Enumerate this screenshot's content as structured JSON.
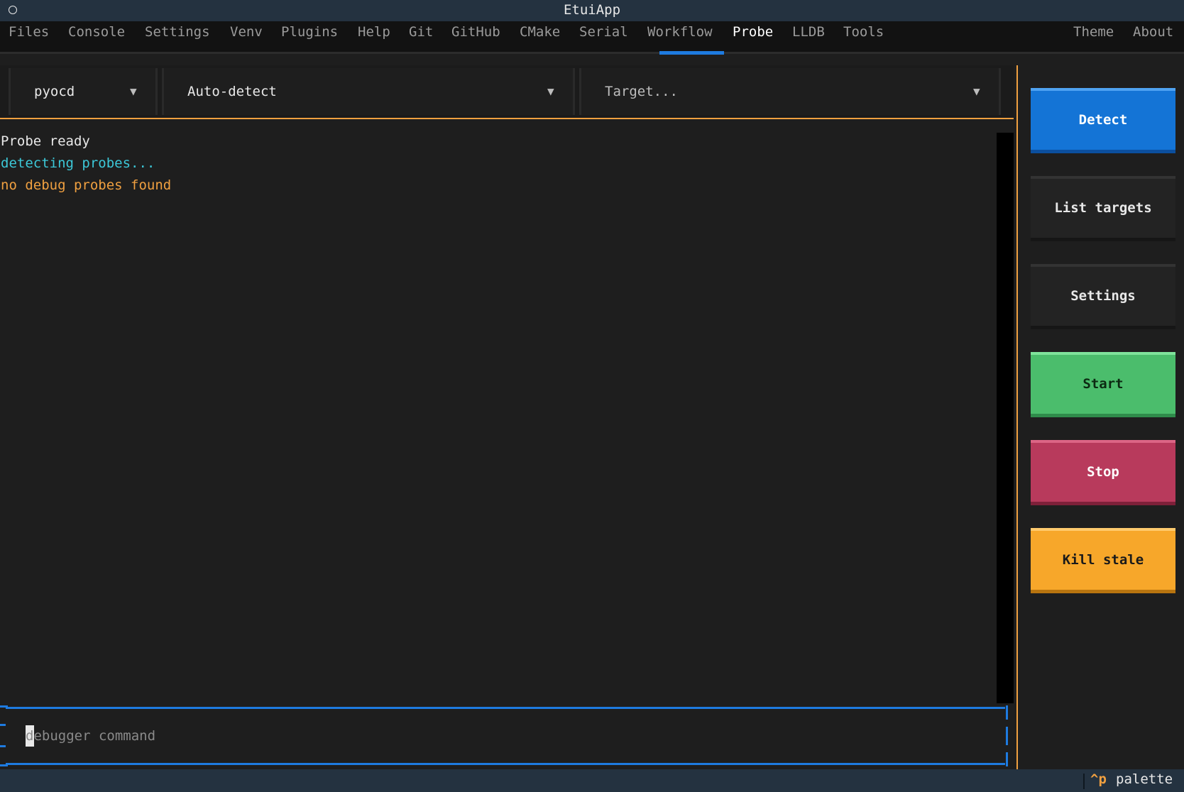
{
  "window": {
    "title": "EtuiApp"
  },
  "menu": {
    "items": [
      {
        "label": "Files",
        "active": false
      },
      {
        "label": "Console",
        "active": false
      },
      {
        "label": "Settings",
        "active": false
      },
      {
        "label": "Venv",
        "active": false
      },
      {
        "label": "Plugins",
        "active": false
      },
      {
        "label": "Help",
        "active": false
      },
      {
        "label": "Git",
        "active": false
      },
      {
        "label": "GitHub",
        "active": false
      },
      {
        "label": "CMake",
        "active": false
      },
      {
        "label": "Serial",
        "active": false
      },
      {
        "label": "Workflow",
        "active": false
      },
      {
        "label": "Probe",
        "active": true
      },
      {
        "label": "LLDB",
        "active": false
      },
      {
        "label": "Tools",
        "active": false
      }
    ],
    "right_items": [
      {
        "label": "Theme"
      },
      {
        "label": "About"
      }
    ]
  },
  "selects": {
    "tool": {
      "value": "pyocd",
      "chevron": "▼"
    },
    "probe": {
      "value": "Auto-detect",
      "chevron": "▼"
    },
    "target": {
      "placeholder": "Target...",
      "chevron": "▼"
    }
  },
  "log": {
    "lines": [
      {
        "text": "Probe ready",
        "color": "#e8e8e8"
      },
      {
        "text": "detecting probes...",
        "color": "#3cc8d8"
      },
      {
        "text": "no debug probes found",
        "color": "#f0a040"
      }
    ]
  },
  "command": {
    "placeholder": "debugger command",
    "value": ""
  },
  "buttons": {
    "detect": {
      "label": "Detect",
      "bg": "#1474d6",
      "fg": "#ffffff"
    },
    "list_targets": {
      "label": "List targets",
      "bg": "#232323",
      "fg": "#e8e8e8"
    },
    "settings": {
      "label": "Settings",
      "bg": "#232323",
      "fg": "#e8e8e8"
    },
    "start": {
      "label": "Start",
      "bg": "#4bbd6c",
      "fg": "#0c2a12"
    },
    "stop": {
      "label": "Stop",
      "bg": "#b83a5c",
      "fg": "#ffffff"
    },
    "kill_stale": {
      "label": "Kill stale",
      "bg": "#f7a72a",
      "fg": "#1a1a1a"
    }
  },
  "status": {
    "shortcut_key": "^p",
    "shortcut_label": "palette"
  },
  "colors": {
    "accent_blue": "#1e7be0",
    "accent_orange": "#f0a040",
    "background": "#1e1e1e"
  }
}
